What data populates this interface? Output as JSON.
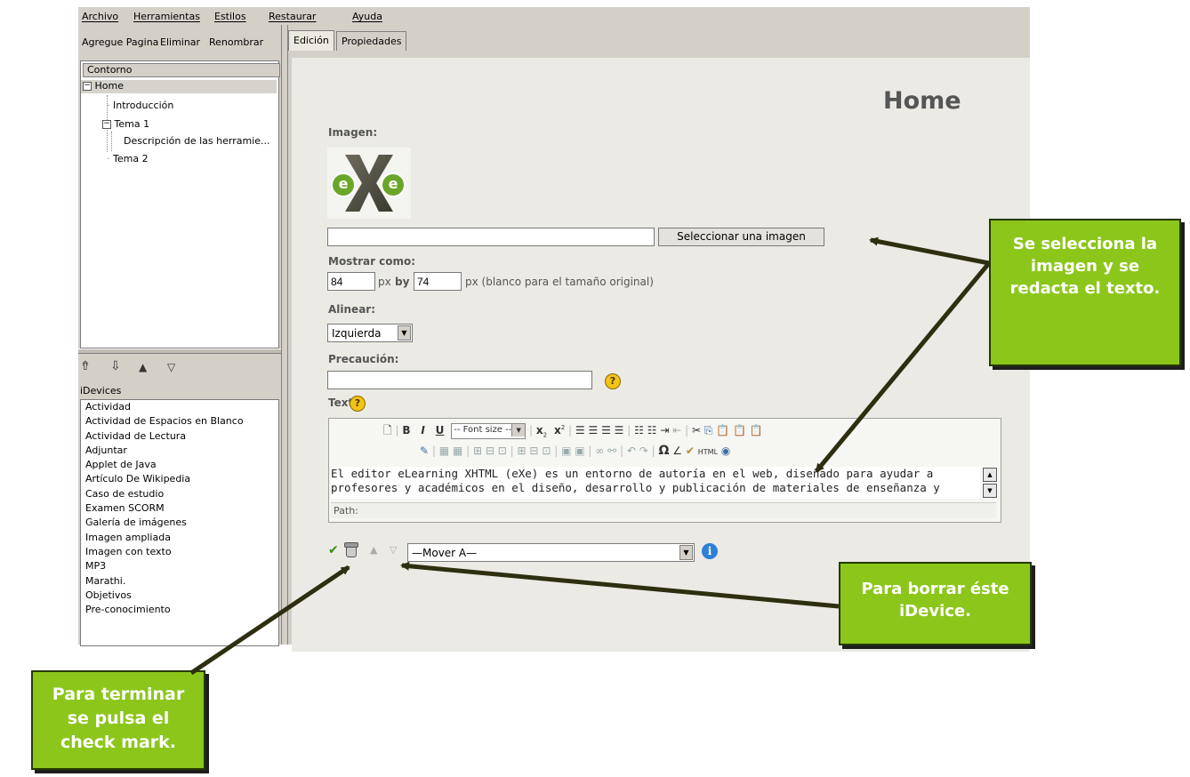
{
  "menu": [
    "Archivo",
    "Herramientas",
    "Estilos",
    "Restaurar",
    "Ayuda"
  ],
  "toolbar": [
    "Agregue Pagina",
    "Eliminar",
    "Renombrar"
  ],
  "outline": {
    "header": "Contorno",
    "items": [
      "Home",
      "Introducción",
      "Tema 1",
      "Descripción de las herramie...",
      "Tema 2"
    ]
  },
  "nav_arrows": [
    "⇮",
    "⇩",
    "▲",
    "▽"
  ],
  "idevices": {
    "title": "iDevices",
    "items": [
      "Actividad",
      "Actividad de Espacios en Blanco",
      "Actividad de Lectura",
      "Adjuntar",
      "Applet de Java",
      "Artículo De Wikipedia",
      "Caso de estudio",
      "Examen SCORM",
      "Galería de imágenes",
      "Imagen ampliada",
      "Imagen con texto",
      "MP3",
      "Marathi.",
      "Objetivos",
      "Pre-conocimiento"
    ]
  },
  "tabs": [
    "Edición",
    "Propiedades"
  ],
  "page_title": "Home",
  "form": {
    "image_label": "Imagen:",
    "image_logo": "e e",
    "image_path": "",
    "select_image_button": "Seleccionar una imagen",
    "show_as_label": "Mostrar como:",
    "width": "84",
    "px_label": "px",
    "by_label": "by",
    "height": "74",
    "size_hint": "px (blanco para el tamaño original)",
    "align_label": "Alinear:",
    "align_value": "Izquierda",
    "caution_label": "Precaución:",
    "caution_value": "",
    "text_label": "Texto",
    "help_glyph": "?"
  },
  "editor": {
    "font_size": "-- Font size --",
    "line1": "El editor eLearning XHTML (eXe) es un entorno de autoría en el web, diseñado para ayudar a",
    "line2": "profesores y académicos en el diseño, desarrollo y publicación de materiales de enseñanza y",
    "path_label": "Path:"
  },
  "actions": {
    "move_to": "—Mover A—",
    "info_glyph": "i"
  },
  "callouts": {
    "select_image": "Se selecciona la imagen y se redacta el texto.",
    "delete": "Para borrar éste iDevice.",
    "finish": "Para terminar se pulsa el check mark."
  },
  "colors": {
    "callout_bg": "#8cc61b",
    "arrow": "#2e2e10",
    "app_bg": "#d4d0c8"
  }
}
